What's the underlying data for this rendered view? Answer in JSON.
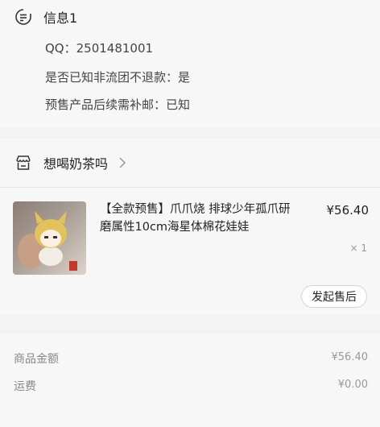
{
  "info": {
    "title": "信息1",
    "qq": "QQ：2501481001",
    "refund": "是否已知非流团不退款：是",
    "postage": "预售产品后续需补邮：已知"
  },
  "shop": {
    "name": "想喝奶茶吗"
  },
  "product": {
    "title": "【全款预售】爪爪烧 排球少年孤爪研磨属性10cm海星体棉花娃娃",
    "price": "¥56.40",
    "quantity": "× 1",
    "after_sale_label": "发起售后"
  },
  "summary": {
    "goods_label": "商品金额",
    "goods_value": "¥56.40",
    "shipping_label": "运费",
    "shipping_value": "¥0.00"
  },
  "icons": {
    "note": "note-icon",
    "shop": "shop-icon",
    "chevron": "chevron-right-icon"
  }
}
